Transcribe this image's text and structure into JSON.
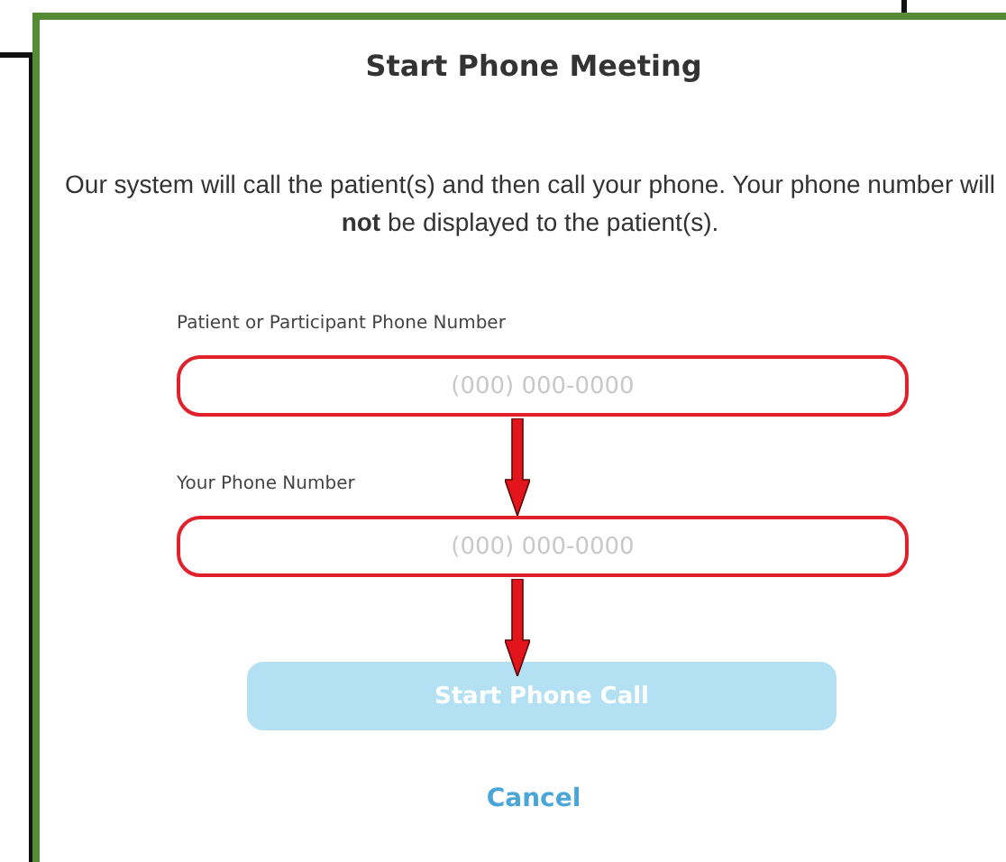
{
  "dialog": {
    "title": "Start Phone Meeting",
    "description": "Our system will call the patient(s) and then call your phone. Your phone number will **not** be displayed to the patient(s).",
    "fields": [
      {
        "label": "Patient or Participant Phone Number",
        "placeholder": "(000) 000-0000",
        "highlighted": true
      },
      {
        "label": "Your Phone Number",
        "placeholder": "(000) 000-0000",
        "highlighted": true
      }
    ],
    "submit_button": {
      "label": "Start Phone Call",
      "disabled": true
    },
    "cancel_link": "Cancel"
  }
}
